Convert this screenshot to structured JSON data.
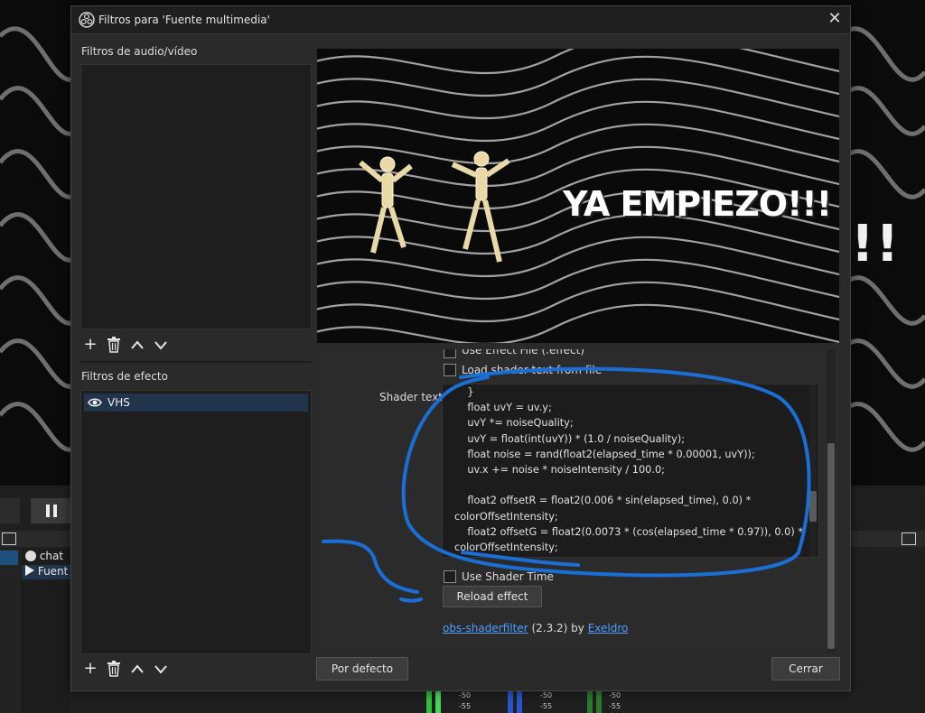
{
  "dialog": {
    "title": "Filtros para 'Fuente multimedia'",
    "close_icon": "close-icon"
  },
  "audio_video_filters": {
    "label": "Filtros de audio/vídeo",
    "items": []
  },
  "effect_filters": {
    "label": "Filtros de efecto",
    "items": [
      {
        "name": "VHS",
        "visible": true,
        "selected": true
      }
    ]
  },
  "preview": {
    "overlay_text": "YA EMPIEZO!!!"
  },
  "properties": {
    "cut_checkbox_label": "Use Effect File (.effect)",
    "load_from_file_label": "Load shader text from file",
    "shader_text_label": "Shader text",
    "shader_lines": [
      "    }",
      "    float uvY = uv.y;",
      "    uvY *= noiseQuality;",
      "    uvY = float(int(uvY)) * (1.0 / noiseQuality);",
      "    float noise = rand(float2(elapsed_time * 0.00001, uvY));",
      "    uv.x += noise * noiseIntensity / 100.0;",
      "",
      "    float2 offsetR = float2(0.006 * sin(elapsed_time), 0.0) *",
      "colorOffsetIntensity;",
      "    float2 offsetG = float2(0.0073 * (cos(elapsed_time * 0.97)), 0.0) *",
      "colorOffsetIntensity;"
    ],
    "use_shader_time_label": "Use Shader Time",
    "reload_button": "Reload effect",
    "plugin_link": "obs-shaderfilter",
    "plugin_version": "(2.3.2) by",
    "author_link": "Exeldro"
  },
  "footer": {
    "defaults_button": "Por defecto",
    "close_button": "Cerrar"
  },
  "background_app": {
    "sources": [
      "chat",
      "Fuent"
    ],
    "big_exclaim": "!!",
    "meter_labels": [
      "-50",
      "-55",
      "-50",
      "-55",
      "-50",
      "-55"
    ]
  },
  "colors": {
    "annotation": "#1a6fd6",
    "link": "#4f9cff",
    "selected_row": "#21344c"
  }
}
